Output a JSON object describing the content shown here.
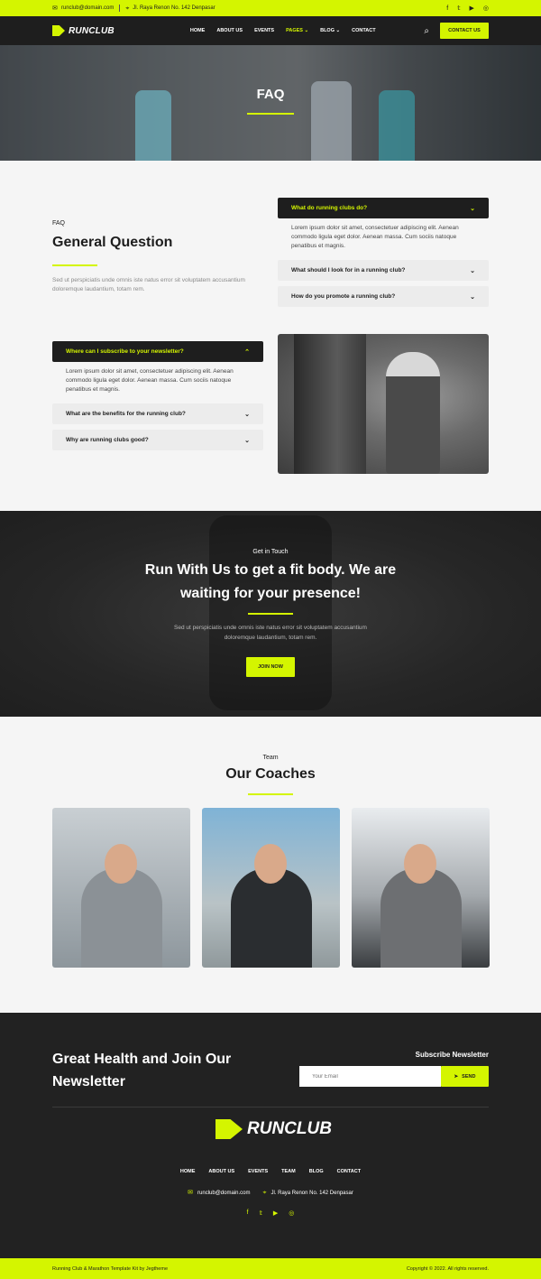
{
  "topbar": {
    "email": "runclub@domain.com",
    "address": "Jl. Raya Renon No. 142 Denpasar",
    "social": [
      {
        "icon": "facebook-icon",
        "glyph": "f"
      },
      {
        "icon": "twitter-icon",
        "glyph": "𝕥"
      },
      {
        "icon": "youtube-icon",
        "glyph": "▶"
      },
      {
        "icon": "instagram-icon",
        "glyph": "◎"
      }
    ]
  },
  "nav": {
    "logo": "RUNCLUB",
    "menu": [
      "HOME",
      "ABOUT US",
      "EVENTS",
      "PAGES",
      "BLOG",
      "CONTACT"
    ],
    "active": "PAGES",
    "cta": "CONTACT US"
  },
  "hero": {
    "title": "FAQ"
  },
  "faq": {
    "label": "FAQ",
    "heading": "General Question",
    "description": "Sed ut perspiciatis unde omnis iste natus error sit voluptatem accusantium doloremque laudantium, totam rem.",
    "right_group": [
      {
        "question": "What do running clubs do?",
        "open": true,
        "answer": "Lorem ipsum dolor sit amet, consectetuer adipiscing elit. Aenean commodo ligula eget dolor. Aenean massa. Cum sociis natoque penatibus et magnis."
      },
      {
        "question": "What should I look for in a running club?",
        "open": false
      },
      {
        "question": "How do you promote a running club?",
        "open": false
      }
    ],
    "left_group": [
      {
        "question": "Where can I subscribe to your newsletter?",
        "open": true,
        "answer": "Lorem ipsum dolor sit amet, consectetuer adipiscing elit. Aenean commodo ligula eget dolor. Aenean massa. Cum sociis natoque penatibus et magnis."
      },
      {
        "question": "What are the benefits for the running club?",
        "open": false
      },
      {
        "question": "Why are running clubs good?",
        "open": false
      }
    ]
  },
  "cta": {
    "subtitle": "Get in Touch",
    "title": "Run With Us to get a fit body. We are waiting for your presence!",
    "description": "Sed ut perspiciatis unde omnis iste natus error sit voluptatem accusantium doloremque laudantium, totam rem.",
    "button": "JOIN NOW"
  },
  "team": {
    "subtitle": "Team",
    "title": "Our Coaches"
  },
  "footer": {
    "headline": "Great Health and Join Our Newsletter",
    "subscribe_title": "Subscribe Newsletter",
    "email_placeholder": "Your Email",
    "send": "SEND",
    "logo": "RUNCLUB",
    "menu": [
      "HOME",
      "ABOUT US",
      "EVENTS",
      "TEAM",
      "BLOG",
      "CONTACT"
    ],
    "email": "runclub@domain.com",
    "address": "Jl. Raya Renon No. 142 Denpasar"
  },
  "bottom": {
    "left": "Running Club & Marathon Template Kit by Jegtheme",
    "right": "Copyright © 2022. All rights reserved."
  },
  "colors": {
    "accent": "#d4f500",
    "dark": "#1e1e1e"
  }
}
